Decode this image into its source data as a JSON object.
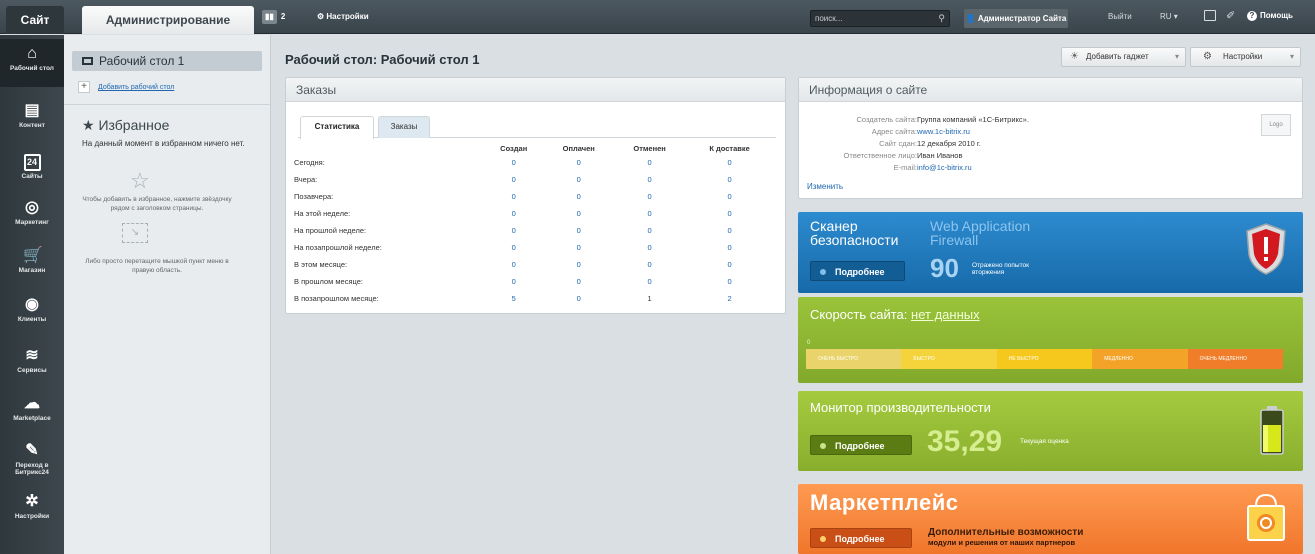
{
  "topbar": {
    "tab_site": "Сайт",
    "tab_admin": "Администрирование",
    "notifications_count": "2",
    "settings_label": "Настройки",
    "search_placeholder": "поиск...",
    "user_label": "Администратор Сайта",
    "logout_label": "Выйти",
    "lang_label": "RU",
    "help_label": "Помощь"
  },
  "leftnav": {
    "items": [
      {
        "label": "Рабочий стол",
        "icon": "home-icon"
      },
      {
        "label": "Контент",
        "icon": "document-icon"
      },
      {
        "label": "Сайты",
        "icon": "calendar-icon",
        "icon_text": "24"
      },
      {
        "label": "Маркетинг",
        "icon": "target-icon"
      },
      {
        "label": "Магазин",
        "icon": "cart-icon"
      },
      {
        "label": "Клиенты",
        "icon": "clients-icon"
      },
      {
        "label": "Сервисы",
        "icon": "layers-icon"
      },
      {
        "label": "Marketplace",
        "icon": "cloud-download-icon"
      },
      {
        "label": "Переход в Битрикс24",
        "icon": "bitrix24-icon"
      },
      {
        "label": "Настройки",
        "icon": "gear-icon"
      }
    ]
  },
  "sidebar": {
    "desktop_label": "Рабочий стол 1",
    "add_desktop_label": "Добавить рабочий стол",
    "favorites_title": "Избранное",
    "favorites_empty": "На данный момент в избранном ничего нет.",
    "favorites_hint1": "Чтобы добавить в избранное, нажмите звёздочку рядом с заголовком страницы.",
    "favorites_hint2": "Либо просто перетащите мышкой пункт меню в правую область."
  },
  "main": {
    "page_title": "Рабочий стол: Рабочий стол 1",
    "add_gadget_label": "Добавить гаджет",
    "settings_label": "Настройки"
  },
  "orders": {
    "title": "Заказы",
    "tab_stats": "Статистика",
    "tab_orders": "Заказы",
    "columns": [
      "Создан",
      "Оплачен",
      "Отменен",
      "К доставке"
    ],
    "rows": [
      {
        "label": "Сегодня:",
        "values": [
          "0",
          "0",
          "0",
          "0"
        ]
      },
      {
        "label": "Вчера:",
        "values": [
          "0",
          "0",
          "0",
          "0"
        ]
      },
      {
        "label": "Позавчера:",
        "values": [
          "0",
          "0",
          "0",
          "0"
        ]
      },
      {
        "label": "На этой неделе:",
        "values": [
          "0",
          "0",
          "0",
          "0"
        ]
      },
      {
        "label": "На прошлой неделе:",
        "values": [
          "0",
          "0",
          "0",
          "0"
        ]
      },
      {
        "label": "На позапрошлой неделе:",
        "values": [
          "0",
          "0",
          "0",
          "0"
        ]
      },
      {
        "label": "В этом месяце:",
        "values": [
          "0",
          "0",
          "0",
          "0"
        ]
      },
      {
        "label": "В прошлом месяце:",
        "values": [
          "0",
          "0",
          "0",
          "0"
        ]
      },
      {
        "label": "В позапрошлом месяце:",
        "values": [
          "5",
          "0",
          "1",
          "2"
        ]
      }
    ]
  },
  "site_info": {
    "title": "Информация о сайте",
    "rows": [
      {
        "key": "Создатель сайта:",
        "value": "Группа компаний «1С-Битрикс».",
        "link": false
      },
      {
        "key": "Адрес сайта:",
        "value": "www.1c-bitrix.ru",
        "link": true
      },
      {
        "key": "Сайт сдан:",
        "value": "12 декабря 2010 г.",
        "link": false
      },
      {
        "key": "Ответственное лицо:",
        "value": "Иван Иванов",
        "link": false
      },
      {
        "key": "E-mail:",
        "value": "info@1c-bitrix.ru",
        "link": true
      }
    ],
    "edit_label": "Изменить",
    "logo_label": "Logo"
  },
  "scanner": {
    "title": "Сканер безопасности",
    "waf_label": "Web Application Firewall",
    "more_label": "Подробнее",
    "count": "90",
    "count_label": "Отражено попыток вторжения"
  },
  "speed": {
    "title": "Скорость сайта:",
    "value": "нет данных",
    "zero_label": "0",
    "scale": [
      {
        "label": "ОЧЕНЬ БЫСТРО",
        "color": "#e9d36a"
      },
      {
        "label": "БЫСТРО",
        "color": "#f4d43a"
      },
      {
        "label": "НЕ БЫСТРО",
        "color": "#f6c81e"
      },
      {
        "label": "МЕДЛЕННО",
        "color": "#f4a329"
      },
      {
        "label": "ОЧЕНЬ МЕДЛЕННО",
        "color": "#ef7d2a"
      }
    ]
  },
  "perf": {
    "title": "Монитор производительности",
    "more_label": "Подробнее",
    "score": "35,29",
    "score_label": "Текущая оценка"
  },
  "market": {
    "title": "Маркетплейс",
    "more_label": "Подробнее",
    "desc": "Дополнительные возможности",
    "desc_sub": "модули и решения от наших партнеров"
  }
}
